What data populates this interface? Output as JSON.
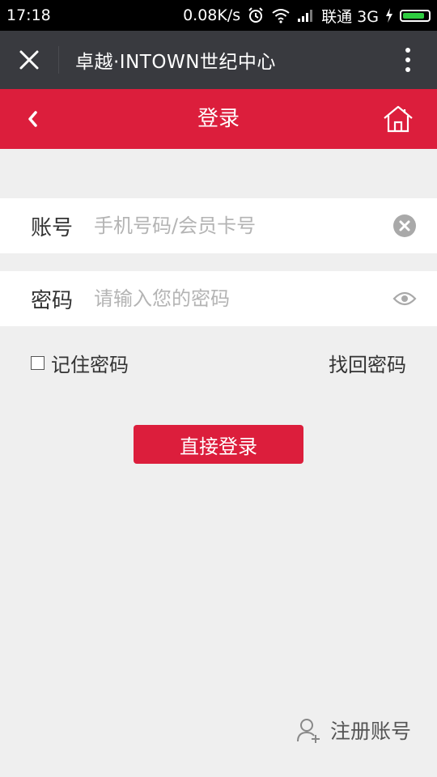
{
  "status_bar": {
    "time": "17:18",
    "speed": "0.08K/s",
    "carrier": "联通 3G",
    "icons": [
      "alarm-icon",
      "wifi-icon",
      "signal-icon",
      "charging-icon",
      "battery-icon"
    ],
    "battery_level": 0.85
  },
  "webview": {
    "title": "卓越·INTOWN世纪中心",
    "close_icon": "close-icon",
    "more_icon": "more-vertical-icon"
  },
  "header": {
    "title": "登录",
    "back_icon": "chevron-left-icon",
    "home_icon": "home-icon",
    "color": "#dc1e3c"
  },
  "form": {
    "account_label": "账号",
    "account_placeholder": "手机号码/会员卡号",
    "account_value": "",
    "password_label": "密码",
    "password_placeholder": "请输入您的密码",
    "password_value": ""
  },
  "options": {
    "remember_label": "记住密码",
    "remember_checked": false,
    "forgot_label": "找回密码"
  },
  "login_button": "直接登录",
  "register_label": "注册账号"
}
